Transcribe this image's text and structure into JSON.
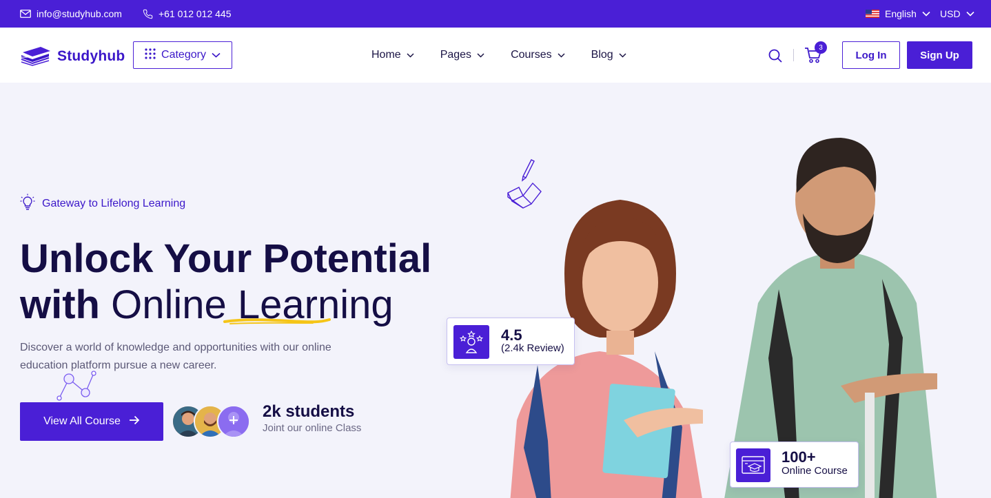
{
  "topbar": {
    "email": "info@studyhub.com",
    "phone": "+61 012 012 445",
    "language": "English",
    "currency": "USD"
  },
  "header": {
    "logo_text": "Studyhub",
    "category_label": "Category",
    "nav": [
      {
        "label": "Home"
      },
      {
        "label": "Pages"
      },
      {
        "label": "Courses"
      },
      {
        "label": "Blog"
      }
    ],
    "cart_count": "3",
    "login_label": "Log In",
    "signup_label": "Sign Up"
  },
  "hero": {
    "tagline": "Gateway to Lifelong Learning",
    "headline_line1": "Unlock Your Potential",
    "headline_line2_bold": "with",
    "headline_line2_light": "Online Learning",
    "description": "Discover a world of knowledge and opportunities with our online education platform pursue a new career.",
    "cta_label": "View All Course",
    "students_count": "2k students",
    "students_sub": "Joint our online Class",
    "rating_value": "4.5",
    "rating_sub": "(2.4k Review)",
    "courses_value": "100+",
    "courses_sub": "Online Course"
  },
  "colors": {
    "brand": "#4a1fd6",
    "heading": "#150e45",
    "accent_yellow": "#f5c518"
  },
  "icons": [
    "mail-icon",
    "phone-icon",
    "us-flag-icon",
    "chevron-down-icon",
    "logo-books-icon",
    "grid-icon",
    "search-icon",
    "cart-icon",
    "lightbulb-icon",
    "arrow-right-icon",
    "star-award-icon",
    "online-course-icon"
  ]
}
